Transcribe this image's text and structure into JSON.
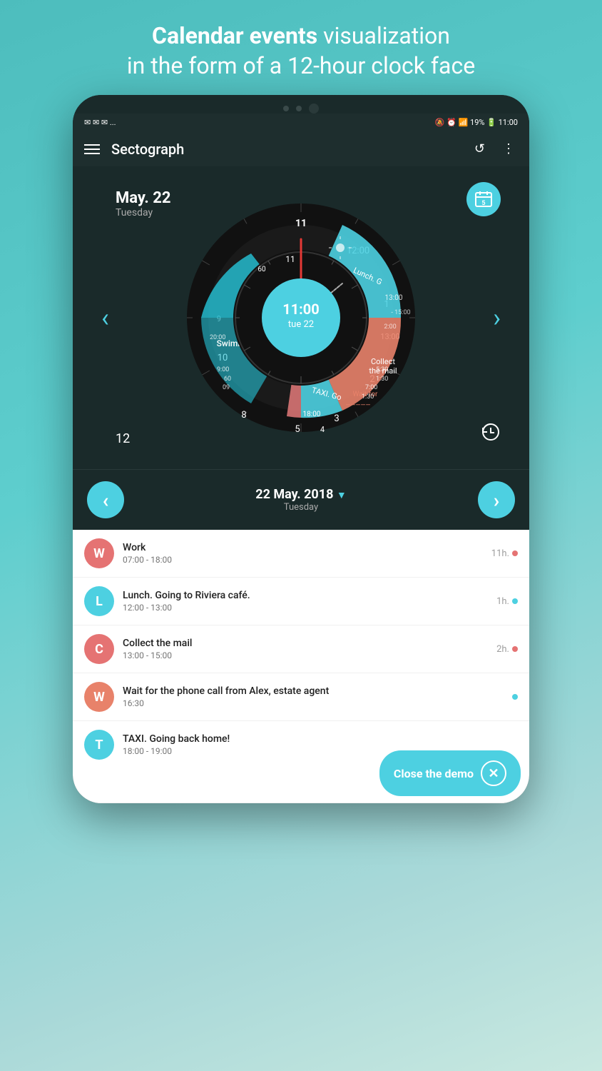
{
  "header": {
    "line1_bold": "Calendar events",
    "line1_rest": " visualization",
    "line2": "in the form of a 12-hour clock face"
  },
  "status_bar": {
    "left_icons": "✉ ✉ ✉ ...",
    "right_text": "🔕 ⏰ 📶 19% 🔋 11:00"
  },
  "app_bar": {
    "title": "Sectograph",
    "menu_icon": "☰",
    "refresh_icon": "↺",
    "more_icon": "⋮"
  },
  "clock": {
    "center_time": "11:00",
    "center_date": "tue 22"
  },
  "date_side": {
    "date": "May. 22",
    "day": "Tuesday",
    "number": "12"
  },
  "bottom_nav": {
    "prev_arrow": "‹",
    "next_arrow": "›",
    "date_text": "22 May. 2018",
    "day_text": "Tuesday",
    "dropdown": "▼"
  },
  "events": [
    {
      "initial": "W",
      "color": "#e57373",
      "title": "Work",
      "time": "07:00 - 18:00",
      "duration": "11h.",
      "dot_color": "#e57373"
    },
    {
      "initial": "L",
      "color": "#4dd0e1",
      "title": "Lunch. Going to Riviera café.",
      "time": "12:00 - 13:00",
      "duration": "1h.",
      "dot_color": "#4dd0e1"
    },
    {
      "initial": "C",
      "color": "#e57373",
      "title": "Collect the mail",
      "time": "13:00 - 15:00",
      "duration": "2h.",
      "dot_color": "#e57373"
    },
    {
      "initial": "W",
      "color": "#e57373",
      "title": "Wait for the phone call from Alex, estate agent",
      "time": "16:30",
      "duration": "",
      "dot_color": "#4dd0e1"
    },
    {
      "initial": "T",
      "color": "#4dd0e1",
      "title": "TAXI. Going back home!",
      "time": "18:00 - 19:00",
      "duration": "",
      "dot_color": ""
    }
  ],
  "close_demo": {
    "label": "Close the demo"
  }
}
